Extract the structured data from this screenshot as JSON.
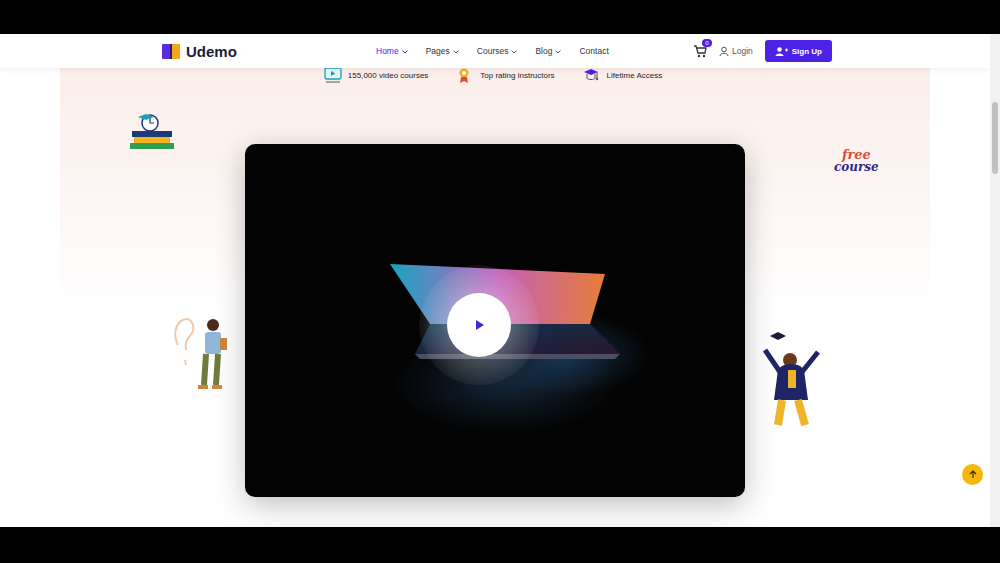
{
  "logo": {
    "text": "Udemo"
  },
  "nav": [
    {
      "label": "Home",
      "selected": true,
      "dropdown": true
    },
    {
      "label": "Pages",
      "selected": false,
      "dropdown": true
    },
    {
      "label": "Courses",
      "selected": false,
      "dropdown": true
    },
    {
      "label": "Blog",
      "selected": false,
      "dropdown": true
    },
    {
      "label": "Contact",
      "selected": false,
      "dropdown": false
    }
  ],
  "cart": {
    "badge": "0"
  },
  "login": "Login",
  "signup": "Sign Up",
  "features": [
    "155,000 video courses",
    "Top rating instructors",
    "Lifetime Access"
  ],
  "sticker": [
    "free",
    "course"
  ]
}
